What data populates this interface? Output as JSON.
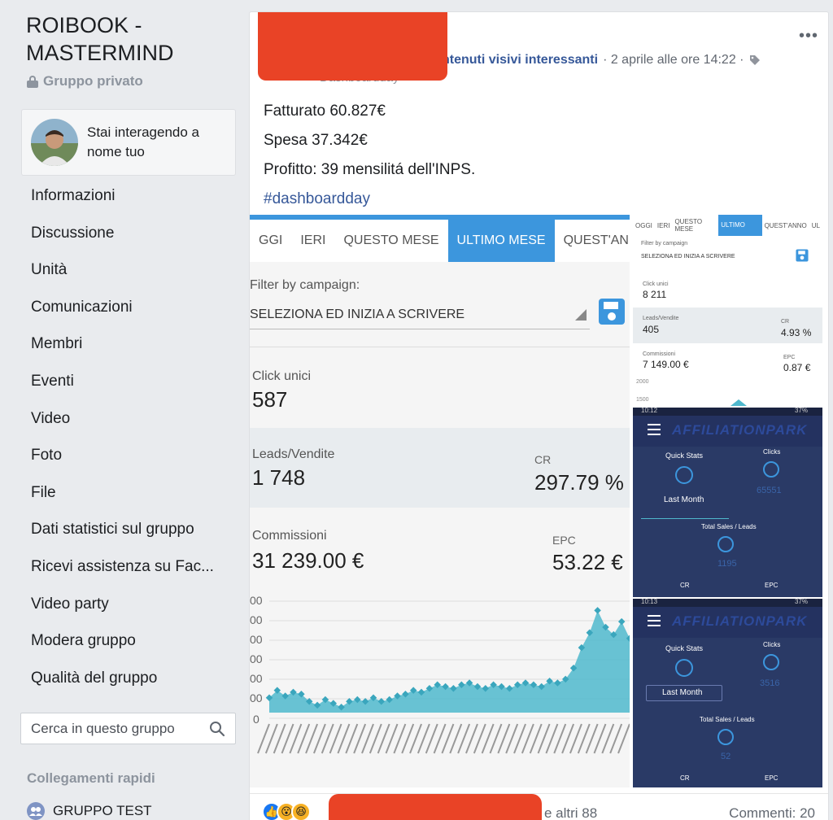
{
  "sidebar": {
    "group_name": "ROIBOOK - MASTERMIND",
    "privacy": "Gruppo privato",
    "identity": "Stai interagendo a nome tuo",
    "nav": [
      "Informazioni",
      "Discussione",
      "Unità",
      "Comunicazioni",
      "Membri",
      "Eventi",
      "Video",
      "Foto",
      "File",
      "Dati statistici sul gruppo",
      "Ricevi assistenza su Fac...",
      "Video party",
      "Modera gruppo",
      "Qualità del gruppo"
    ],
    "search_placeholder": "Cerca in questo gruppo",
    "quick_links_title": "Collegamenti rapidi",
    "quick_link": "GRUPPO TEST"
  },
  "post": {
    "subtext": "Dashboardday",
    "activity": "ntenuti visivi interessanti",
    "date": "· 2 aprile alle ore 14:22 ·",
    "lines": [
      "Fatturato 60.827€",
      "Spesa 37.342€",
      "Profitto: 39 mensilitá dell'INPS."
    ],
    "hashtag": "#dashboardday",
    "more": "•••",
    "others": "e altri 88",
    "comments": "Commenti: 20"
  },
  "main_shot": {
    "tabs": [
      "GGI",
      "IERI",
      "QUESTO MESE",
      "ULTIMO MESE",
      "QUEST'ANNO"
    ],
    "filter_label": "Filter by campaign:",
    "filter_value": "SELEZIONA ED INIZIA A SCRIVERE",
    "click_label": "Click unici",
    "click_value": "587",
    "leads_label": "Leads/Vendite",
    "leads_value": "1 748",
    "cr_label": "CR",
    "cr_value": "297.79 %",
    "comm_label": "Commissioni",
    "comm_value": "31 239.00 €",
    "epc_label": "EPC",
    "epc_value": "53.22 €",
    "y_ticks": [
      "00",
      "00",
      "00",
      "00",
      "00",
      "00",
      "0"
    ]
  },
  "side1": {
    "tabs": [
      "OGGI",
      "IERI",
      "QUESTO MESE",
      "ULTIMO MESE",
      "QUEST'ANNO",
      "UL"
    ],
    "filter_label": "Filter by campaign",
    "filter_value": "SELEZIONA ED INIZIA A SCRIVERE",
    "click_label": "Click unici",
    "click_value": "8 211",
    "leads_label": "Leads/Vendite",
    "leads_value": "405",
    "cr_label": "CR",
    "cr_value": "4.93 %",
    "comm_label": "Commissioni",
    "comm_value": "7 149.00 €",
    "epc_label": "EPC",
    "epc_value": "0.87 €",
    "tick_2000": "2000",
    "tick_1500": "1500"
  },
  "side2": {
    "status": "10:12",
    "battery": "37%",
    "brand": "AFFILIATIONPARK",
    "quick_stats": "Quick Stats",
    "clicks_label": "Clicks",
    "clicks_value": "65551",
    "period": "Last Month",
    "total_label": "Total Sales / Leads",
    "total_value": "1195",
    "cr": "CR",
    "epc": "EPC"
  },
  "side3": {
    "status": "10:13",
    "battery": "37%",
    "brand": "AFFILIATIONPARK",
    "quick_stats": "Quick Stats",
    "clicks_label": "Clicks",
    "clicks_value": "3516",
    "period": "Last Month",
    "total_label": "Total Sales / Leads",
    "total_value": "52",
    "cr": "CR",
    "epc": "EPC"
  },
  "colors": {
    "accent": "#365899",
    "redaction": "#e94326",
    "chart_fill": "#4fb8cd",
    "tab_active": "#3c96dd"
  },
  "chart_data": {
    "type": "area",
    "title": "",
    "xlabel": "",
    "ylabel": "",
    "series": [
      {
        "values": [
          80,
          120,
          90,
          110,
          100,
          60,
          40,
          70,
          50,
          30,
          60,
          70,
          60,
          80,
          60,
          70,
          90,
          100,
          120,
          110,
          130,
          150,
          140,
          130,
          150,
          160,
          140,
          130,
          150,
          140,
          130,
          150,
          160,
          150,
          140,
          170,
          160,
          180,
          240,
          350,
          430,
          550,
          460,
          420,
          490,
          400
        ]
      }
    ]
  }
}
